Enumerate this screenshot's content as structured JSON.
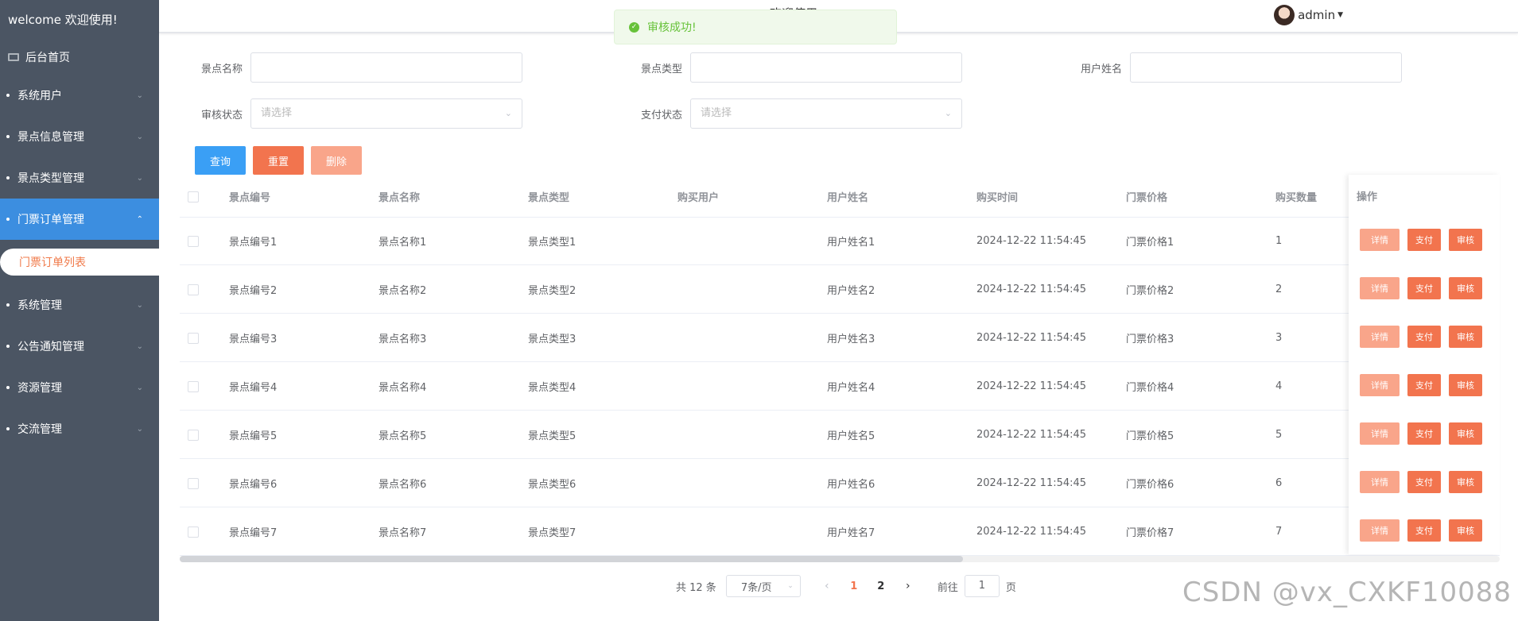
{
  "sidebar": {
    "welcome": "welcome 欢迎使用!",
    "home": "后台首页",
    "items": [
      {
        "label": "系统用户"
      },
      {
        "label": "景点信息管理"
      },
      {
        "label": "景点类型管理"
      },
      {
        "label": "门票订单管理"
      },
      {
        "label": "系统管理"
      },
      {
        "label": "公告通知管理"
      },
      {
        "label": "资源管理"
      },
      {
        "label": "交流管理"
      }
    ],
    "active_sub": "门票订单列表"
  },
  "header": {
    "title": "欢迎使用...app",
    "user": "admin"
  },
  "toast": {
    "message": "审核成功!"
  },
  "filters": {
    "spot_name": {
      "label": "景点名称",
      "value": ""
    },
    "spot_type": {
      "label": "景点类型",
      "value": ""
    },
    "user_name": {
      "label": "用户姓名",
      "value": ""
    },
    "audit_status": {
      "label": "审核状态",
      "placeholder": "请选择"
    },
    "pay_status": {
      "label": "支付状态",
      "placeholder": "请选择"
    }
  },
  "actions": {
    "query": "查询",
    "reset": "重置",
    "delete": "删除"
  },
  "table": {
    "headers": [
      "景点编号",
      "景点名称",
      "景点类型",
      "购买用户",
      "用户姓名",
      "购买时间",
      "门票价格",
      "购买数量",
      "操作"
    ],
    "rows": [
      [
        "景点编号1",
        "景点名称1",
        "景点类型1",
        "",
        "用户姓名1",
        "2024-12-22 11:54:45",
        "门票价格1",
        "1"
      ],
      [
        "景点编号2",
        "景点名称2",
        "景点类型2",
        "",
        "用户姓名2",
        "2024-12-22 11:54:45",
        "门票价格2",
        "2"
      ],
      [
        "景点编号3",
        "景点名称3",
        "景点类型3",
        "",
        "用户姓名3",
        "2024-12-22 11:54:45",
        "门票价格3",
        "3"
      ],
      [
        "景点编号4",
        "景点名称4",
        "景点类型4",
        "",
        "用户姓名4",
        "2024-12-22 11:54:45",
        "门票价格4",
        "4"
      ],
      [
        "景点编号5",
        "景点名称5",
        "景点类型5",
        "",
        "用户姓名5",
        "2024-12-22 11:54:45",
        "门票价格5",
        "5"
      ],
      [
        "景点编号6",
        "景点名称6",
        "景点类型6",
        "",
        "用户姓名6",
        "2024-12-22 11:54:45",
        "门票价格6",
        "6"
      ],
      [
        "景点编号7",
        "景点名称7",
        "景点类型7",
        "",
        "用户姓名7",
        "2024-12-22 11:54:45",
        "门票价格7",
        "7"
      ]
    ],
    "row_actions": {
      "detail": "详情",
      "pay": "支付",
      "audit": "审核"
    }
  },
  "pagination": {
    "total": "共 12 条",
    "page_size": "7条/页",
    "pages": [
      "1",
      "2"
    ],
    "current": "1",
    "goto_prefix": "前往",
    "goto_value": "1",
    "goto_suffix": "页"
  },
  "watermark": "CSDN @vx_CXKF10088"
}
